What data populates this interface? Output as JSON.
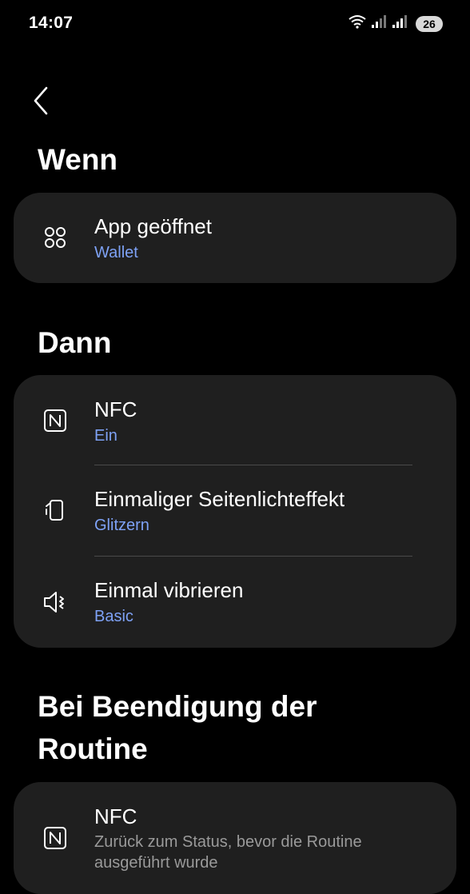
{
  "status_bar": {
    "time": "14:07",
    "battery": "26",
    "icons": [
      "wifi-icon",
      "signal-icon",
      "signal-icon"
    ]
  },
  "nav": {
    "back_icon": "chevron-left-icon"
  },
  "sections": {
    "when": {
      "title": "Wenn",
      "items": [
        {
          "icon": "apps-icon",
          "title": "App geöffnet",
          "subtitle": "Wallet"
        }
      ]
    },
    "then": {
      "title": "Dann",
      "items": [
        {
          "icon": "nfc-icon",
          "title": "NFC",
          "subtitle": "Ein"
        },
        {
          "icon": "edge-lighting-icon",
          "title": "Einmaliger Seitenlichteffekt",
          "subtitle": "Glitzern"
        },
        {
          "icon": "vibrate-icon",
          "title": "Einmal vibrieren",
          "subtitle": "Basic"
        }
      ]
    },
    "on_end": {
      "title_line1": "Bei Beendigung der",
      "title_line2": "Routine",
      "items": [
        {
          "icon": "nfc-icon",
          "title": "NFC",
          "subtitle": "Zurück zum Status, bevor die Routine",
          "subtitle_line2": "ausgeführt wurde"
        }
      ]
    }
  },
  "colors": {
    "background": "#000000",
    "card": "#1f1f1f",
    "accent": "#7ea2f6",
    "divider": "#4a4a4a"
  }
}
